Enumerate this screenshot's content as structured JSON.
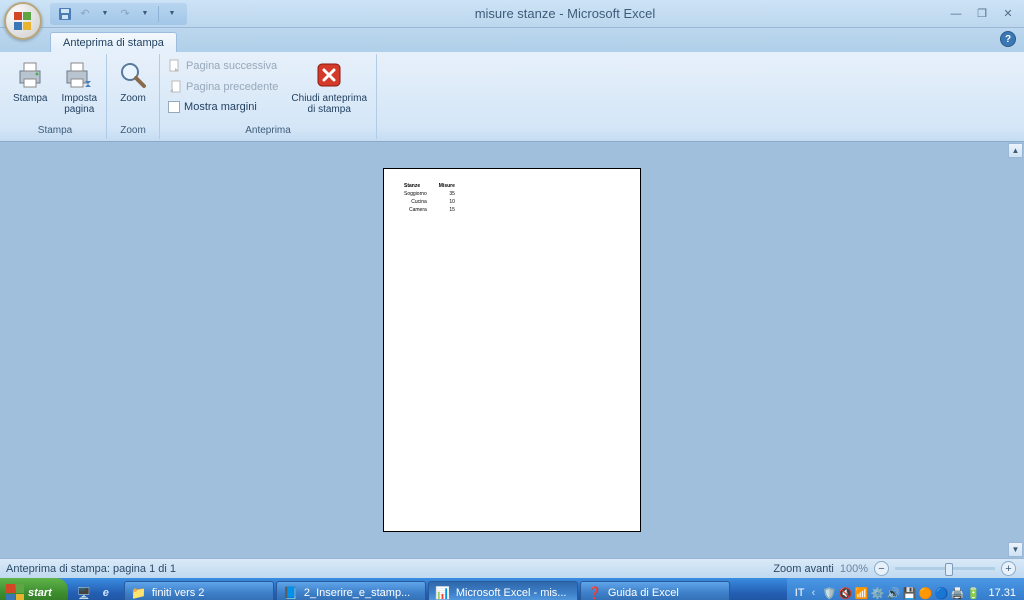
{
  "title": "misure stanze - Microsoft Excel",
  "tab": "Anteprima di stampa",
  "ribbon": {
    "stampa": {
      "stampa": "Stampa",
      "imposta": "Imposta\npagina",
      "group": "Stampa"
    },
    "zoom": {
      "zoom": "Zoom",
      "group": "Zoom"
    },
    "anteprima": {
      "next": "Pagina successiva",
      "prev": "Pagina precedente",
      "margins": "Mostra margini",
      "close": "Chiudi anteprima\ndi stampa",
      "group": "Anteprima"
    }
  },
  "status": {
    "left": "Anteprima di stampa: pagina 1 di 1",
    "zoom_label": "Zoom avanti",
    "zoom_pct": "100%"
  },
  "page": {
    "headers": [
      "Stanze",
      "Misure"
    ],
    "rows": [
      [
        "Soggiorno",
        "35"
      ],
      [
        "Cucina",
        "10"
      ],
      [
        "Camera",
        "15"
      ]
    ]
  },
  "taskbar": {
    "start": "start",
    "items": [
      {
        "label": "finiti vers 2",
        "icon": "📁"
      },
      {
        "label": "2_Inserire_e_stamp...",
        "icon": "📘"
      },
      {
        "label": "Microsoft Excel - mis...",
        "icon": "📊",
        "active": true
      },
      {
        "label": "Guida di Excel",
        "icon": "❓"
      }
    ],
    "lang": "IT",
    "clock": "17.31"
  }
}
